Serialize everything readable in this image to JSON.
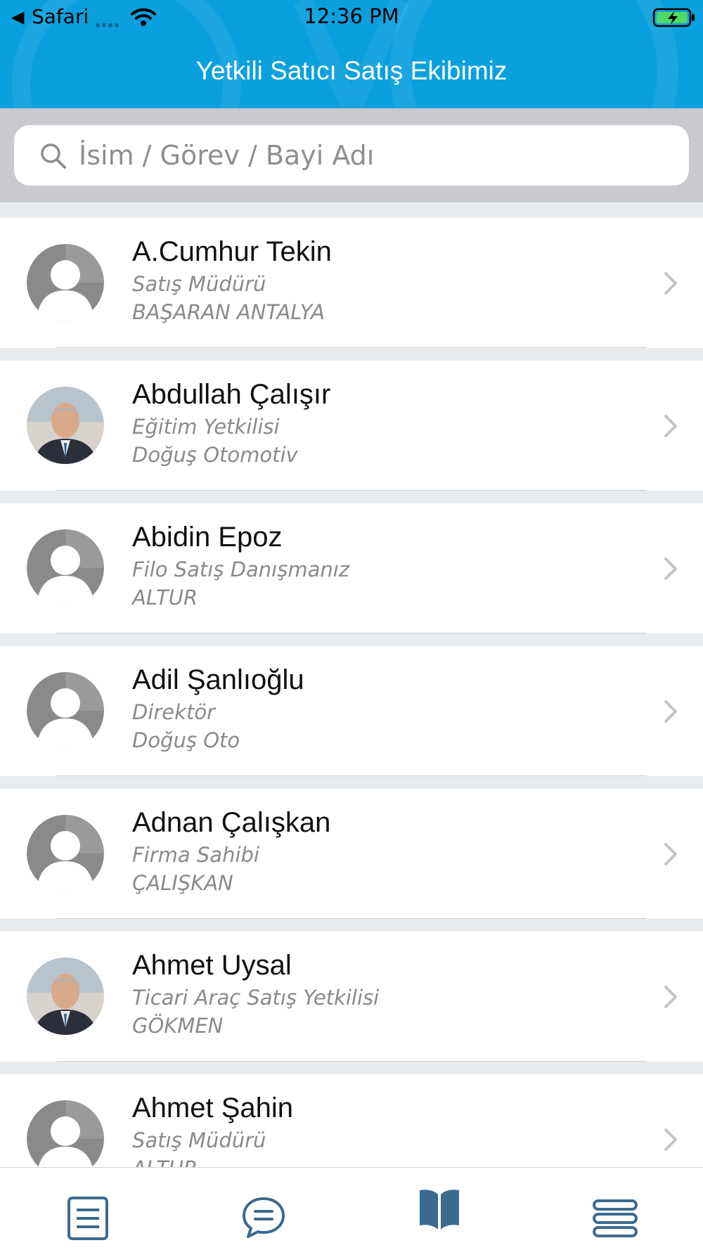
{
  "status_bar": {
    "back_glyph": "◀",
    "carrier": "Safari",
    "time": "12:36 PM",
    "icons": [
      "signal-dots-icon",
      "wifi-icon",
      "battery-charging-icon"
    ]
  },
  "header": {
    "title": "Yetkili Satıcı Satış Ekibimiz",
    "color": "#0aa0de"
  },
  "search": {
    "placeholder": "İsim / Görev / Bayi Adı",
    "icon": "search-icon"
  },
  "contacts": [
    {
      "name": "A.Cumhur Tekin",
      "role": "Satış Müdürü",
      "dealer": "BAŞARAN ANTALYA",
      "avatar": "default-avatar"
    },
    {
      "name": "Abdullah Çalışır",
      "role": "Eğitim Yetkilisi",
      "dealer": "Doğuş Otomotiv",
      "avatar": "photo-avatar"
    },
    {
      "name": "Abidin Epoz",
      "role": "Filo Satış Danışmanız",
      "dealer": "ALTUR",
      "avatar": "default-avatar"
    },
    {
      "name": "Adil Şanlıoğlu",
      "role": "Direktör",
      "dealer": "Doğuş Oto",
      "avatar": "default-avatar"
    },
    {
      "name": "Adnan Çalışkan",
      "role": "Firma Sahibi",
      "dealer": "ÇALIŞKAN",
      "avatar": "default-avatar"
    },
    {
      "name": "Ahmet Uysal",
      "role": "Ticari Araç Satış Yetkilisi",
      "dealer": "GÖKMEN",
      "avatar": "photo-avatar"
    },
    {
      "name": "Ahmet Şahin",
      "role": "Satış Müdürü",
      "dealer": "ALTUR",
      "avatar": "default-avatar"
    }
  ],
  "tabbar": {
    "tabs": [
      {
        "icon": "document-list-icon",
        "active": false
      },
      {
        "icon": "chat-bubble-icon",
        "active": false
      },
      {
        "icon": "open-book-icon",
        "active": true
      },
      {
        "icon": "stacked-menu-icon",
        "active": false
      }
    ],
    "active_color": "#3d6a8f",
    "inactive_color": "#3d6a8f"
  }
}
